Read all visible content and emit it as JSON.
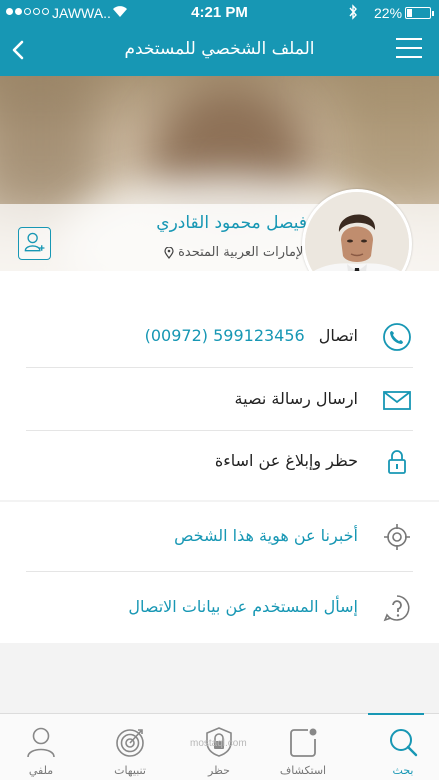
{
  "status_bar": {
    "carrier": "JAWWA..",
    "time": "4:21 PM",
    "battery_percent": "22%",
    "battery_level": 0.22
  },
  "nav": {
    "title": "الملف الشخصي للمستخدم"
  },
  "profile": {
    "name": "فيصل محمود القادري",
    "location": "الإمارات العربية المتحدة"
  },
  "actions": [
    {
      "label": "اتصال",
      "phone": "599123456  (00972)",
      "icon": "phone-icon"
    },
    {
      "label": "ارسال رسالة نصية",
      "icon": "envelope-icon"
    },
    {
      "label": "حظر وإبلاغ عن اساءة",
      "icon": "lock-icon"
    }
  ],
  "extras": [
    {
      "label": "أخبرنا عن هوية هذا الشخص",
      "icon": "target-icon"
    },
    {
      "label": "إسأل المستخدم عن بيانات الاتصال",
      "icon": "question-icon"
    }
  ],
  "tabs": [
    {
      "label": "بحث",
      "icon": "search-icon",
      "active": true
    },
    {
      "label": "استكشاف",
      "icon": "explore-icon",
      "active": false
    },
    {
      "label": "حظر",
      "icon": "shield-icon",
      "active": false
    },
    {
      "label": "تنبيهات",
      "icon": "bullseye-icon",
      "active": false
    },
    {
      "label": "ملفي",
      "icon": "user-icon",
      "active": false
    }
  ],
  "watermark": "mostaql.com",
  "colors": {
    "accent": "#1797b4",
    "text": "#222222",
    "background": "#f3f3f3"
  }
}
